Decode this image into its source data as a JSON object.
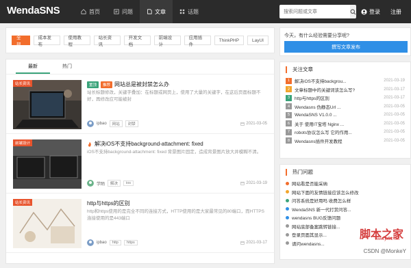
{
  "header": {
    "logo": "WendaSNS",
    "nav": [
      {
        "label": "首页",
        "icon": "home-icon"
      },
      {
        "label": "问题",
        "icon": "question-icon"
      },
      {
        "label": "文章",
        "icon": "article-icon"
      },
      {
        "label": "话题",
        "icon": "topic-icon"
      }
    ],
    "search_placeholder": "搜索问题或文章",
    "login": "登录",
    "register": "注册"
  },
  "categories": [
    "全部",
    "成本发布",
    "使用教程",
    "站长资讯",
    "开发文档",
    "前端设计",
    "应用插件",
    "ThinkPHP",
    "LayUI"
  ],
  "tabs": [
    "最新",
    "热门"
  ],
  "articles": [
    {
      "badge": "站长资讯",
      "tags": [
        "置顶",
        "推荐"
      ],
      "title": "网站总是被封禁怎么办",
      "desc": "站长标题修改，关键字叠加，在标题或网页上，使用了大量的关键字，在对应关键字的标题，页面是比较，一篇... 再修改应对...",
      "desc_render": "站长标题修改，关键字叠加：在标题或网页上，使用了大量的关键字，在这后页面标题不好，再修改应可能被封",
      "author": "ipbao",
      "mtags": [
        "网站",
        "封禁"
      ],
      "date": "2021-03-05"
    },
    {
      "badge": "前端设计",
      "tags": [],
      "title": "解决iOS不支持background-attachment: fixed",
      "desc": "iOS不支持background-attachment: fixed 背景图片固定，造成背景图片放大并模糊不清。",
      "author": "学陌",
      "mtags": [
        "解决",
        "ios"
      ],
      "date": "2021-03-19"
    },
    {
      "badge": "站长资讯",
      "tags": [],
      "title": "http与https的区别",
      "desc": "http和https使用的是完全不同的连接方式，HTTP使用的是大家最常见的80端口，而HTTPS连接使用的是443端口",
      "author": "ipbao",
      "mtags": [
        "http",
        "https"
      ],
      "date": "2021-03-17"
    }
  ],
  "sidebar": {
    "ask_prompt": "今天，有什么经验需要分享呢?",
    "ask_button": "撰写文章发布",
    "featured_title": "关注文章",
    "featured": [
      {
        "title": "解决iOS不支持backgrou...",
        "date": "2021-03-19"
      },
      {
        "title": "文章标题中的关键词该怎么写?",
        "date": "2021-03-17"
      },
      {
        "title": "http与https的区别",
        "date": "2021-03-17"
      },
      {
        "title": "Wendasns 伪静态Url ...",
        "date": "2021-03-05"
      },
      {
        "title": "WendaSNS V1.0.0 ...",
        "date": "2021-03-05"
      },
      {
        "title": "关于 使用IT宝塔 Nginx ...",
        "date": "2021-03-05"
      },
      {
        "title": "robots协议怎么写 它的作用...",
        "date": "2021-03-05"
      },
      {
        "title": "Wendasns插件开发教程",
        "date": "2021-03-05"
      }
    ],
    "featured_colors": [
      "#f26d2c",
      "#f2a52c",
      "#3aa37a",
      "#999999",
      "#999999",
      "#999999",
      "#999999",
      "#999999"
    ],
    "hot_title": "热门问题",
    "hot": [
      {
        "title": "网站看是否能采纳",
        "date": "",
        "color": "#f26d2c"
      },
      {
        "title": "网站下面的友情链接应该怎么修改",
        "date": "",
        "color": "#f2a52c"
      },
      {
        "title": "问答系统是好用吗 收费怎么样",
        "date": "",
        "color": "#3aa37a"
      },
      {
        "title": "WendaSNS 新一代打赏问答...",
        "date": "",
        "color": "#2f8fe6"
      },
      {
        "title": "wendasns BUG反馈问题",
        "date": "",
        "color": "#2f8fe6"
      },
      {
        "title": "网站底部备案跳转链接...",
        "date": "",
        "color": "#999999"
      },
      {
        "title": "登录页面其显示...",
        "date": "",
        "color": "#999999"
      },
      {
        "title": "请问wendasns...",
        "date": "",
        "color": "#999999"
      }
    ],
    "watermark": "脚本之家",
    "watermark_url": "www.jb51.net",
    "csdn_mark": "CSDN @MonkeY"
  }
}
